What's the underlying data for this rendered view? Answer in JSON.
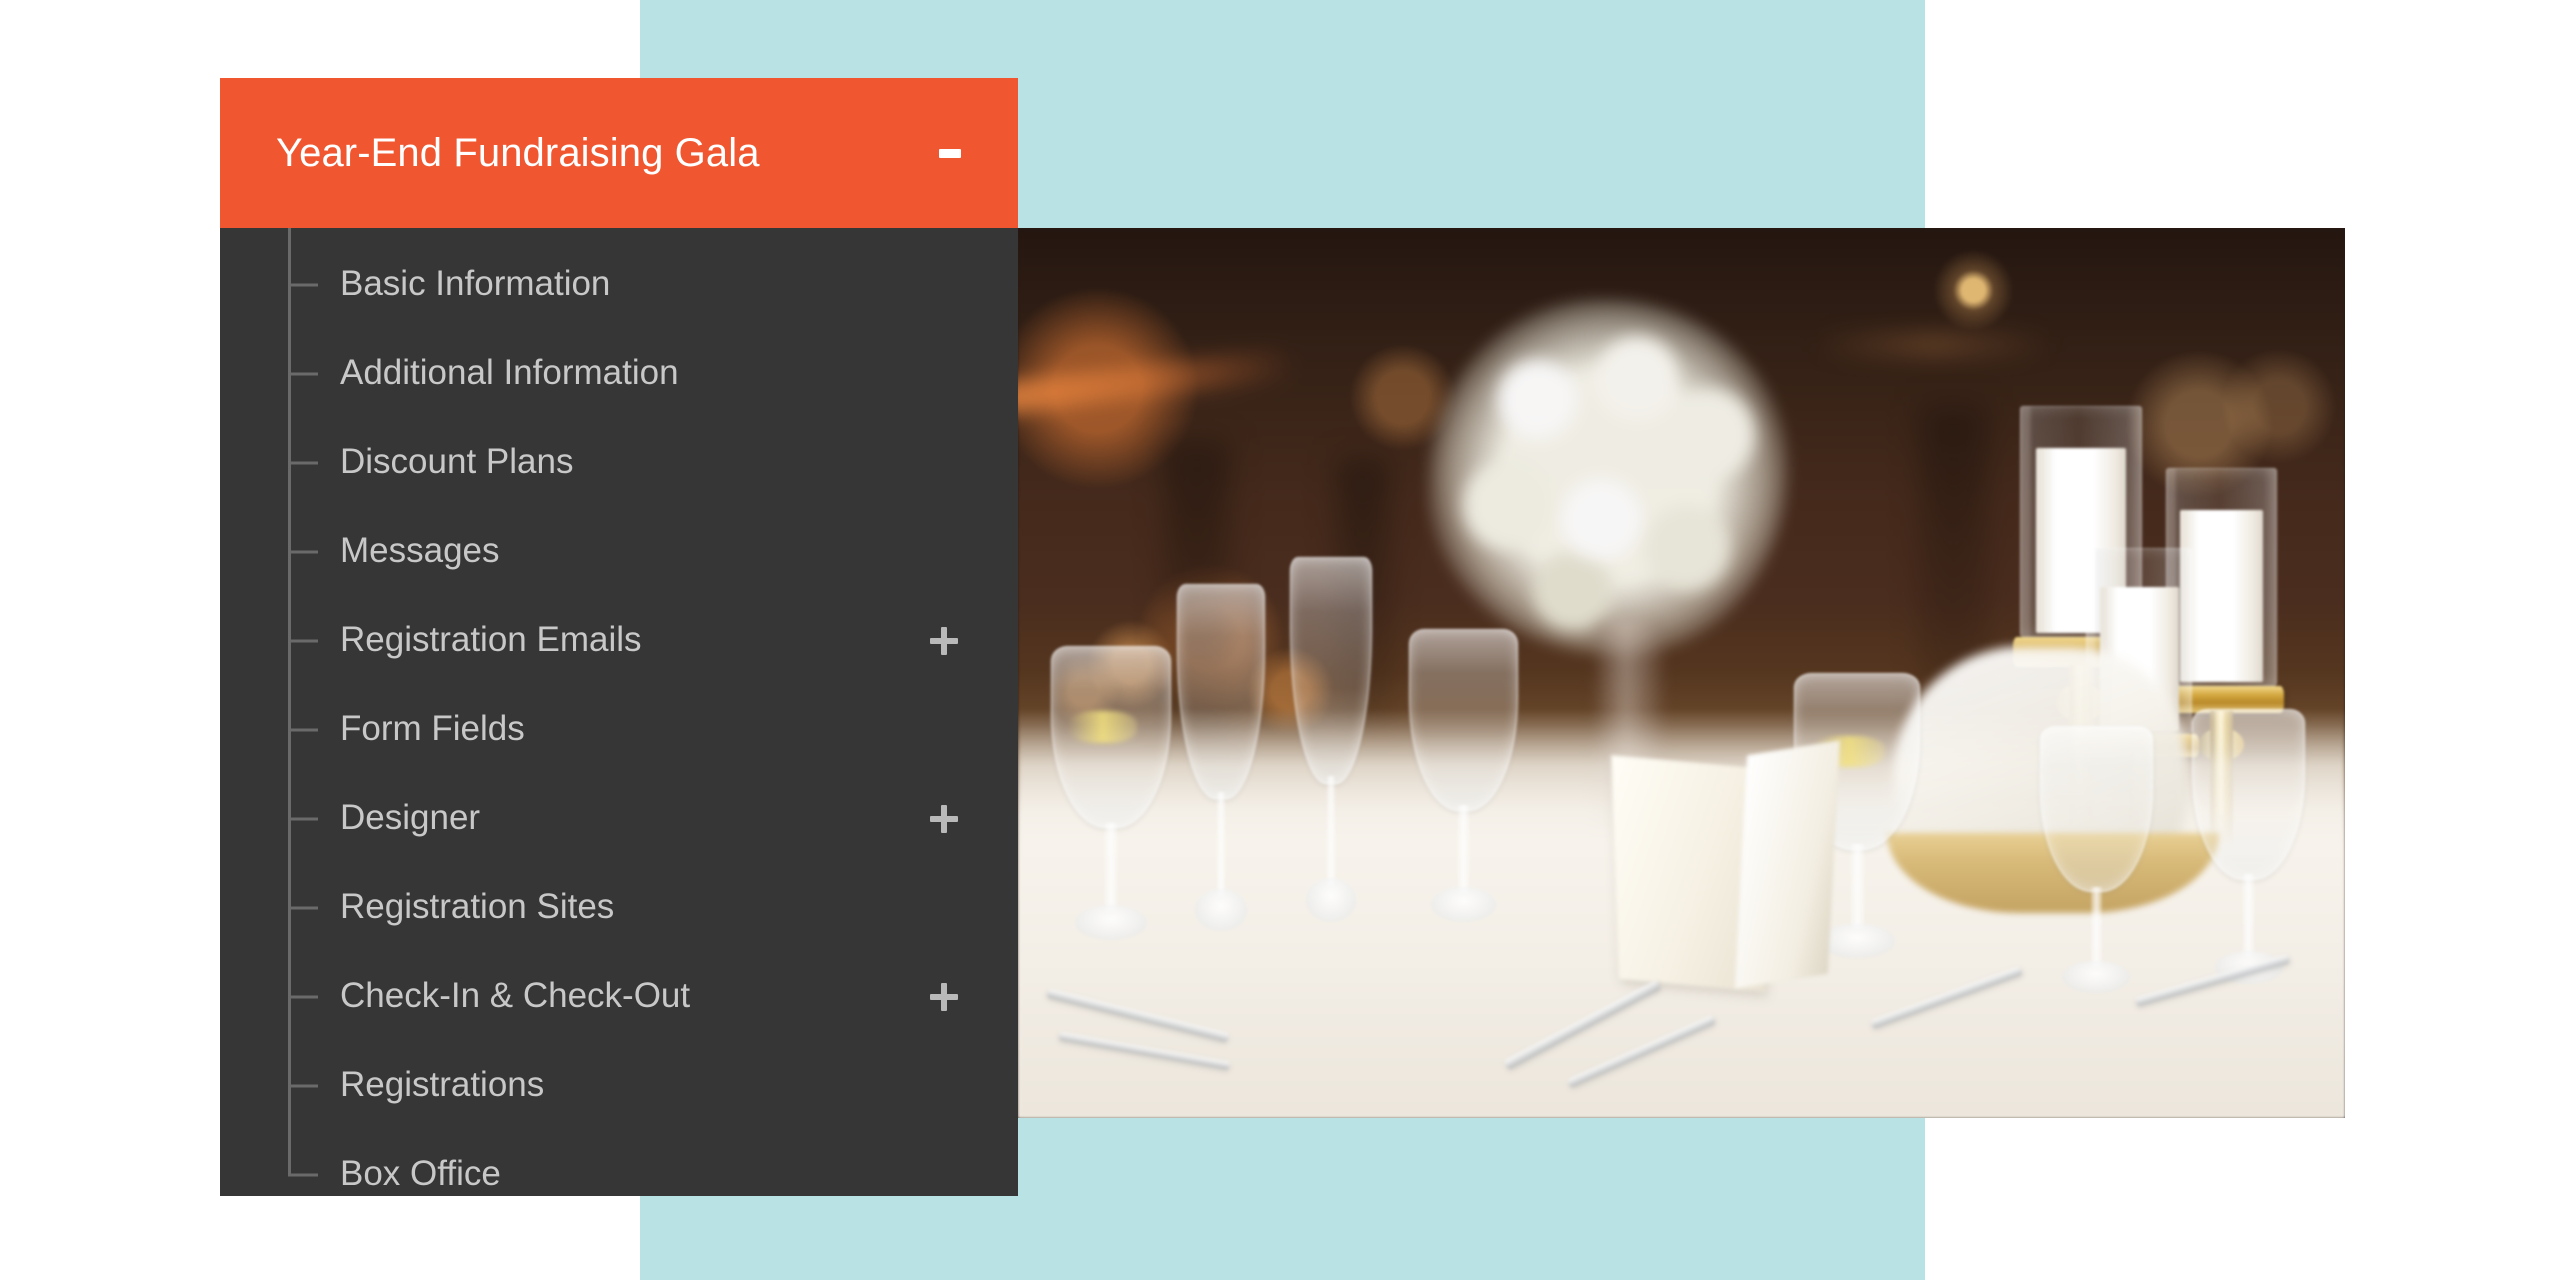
{
  "colors": {
    "accent_orange": "#F0562F",
    "panel_dark": "#363636",
    "decor_teal": "#B8E2E4",
    "page_background": "#FFFFFF",
    "nav_label_text": "#C8C8C8",
    "tree_line": "#6A6A6A",
    "header_title_text": "#FFFFFF"
  },
  "header": {
    "title": "Year-End Fundraising Gala",
    "collapse_icon": "minus-icon",
    "collapse_label": "-",
    "expanded": true
  },
  "nav": {
    "items": [
      {
        "label": "Basic Information",
        "expander": null,
        "expander_label": ""
      },
      {
        "label": "Additional Information",
        "expander": null,
        "expander_label": ""
      },
      {
        "label": "Discount Plans",
        "expander": null,
        "expander_label": ""
      },
      {
        "label": "Messages",
        "expander": null,
        "expander_label": ""
      },
      {
        "label": "Registration Emails",
        "expander": "plus-icon",
        "expander_label": "+"
      },
      {
        "label": "Form Fields",
        "expander": null,
        "expander_label": ""
      },
      {
        "label": "Designer",
        "expander": "plus-icon",
        "expander_label": "+"
      },
      {
        "label": "Registration Sites",
        "expander": null,
        "expander_label": ""
      },
      {
        "label": "Check-In & Check-Out",
        "expander": "plus-icon",
        "expander_label": "+"
      },
      {
        "label": "Registrations",
        "expander": null,
        "expander_label": ""
      },
      {
        "label": "Box Office",
        "expander": null,
        "expander_label": ""
      }
    ]
  },
  "media": {
    "hero_photo_alt": "Blurred banquet table setting with gold candle holders, white pillar candles, white hydrangea centerpiece and crystal glassware"
  }
}
